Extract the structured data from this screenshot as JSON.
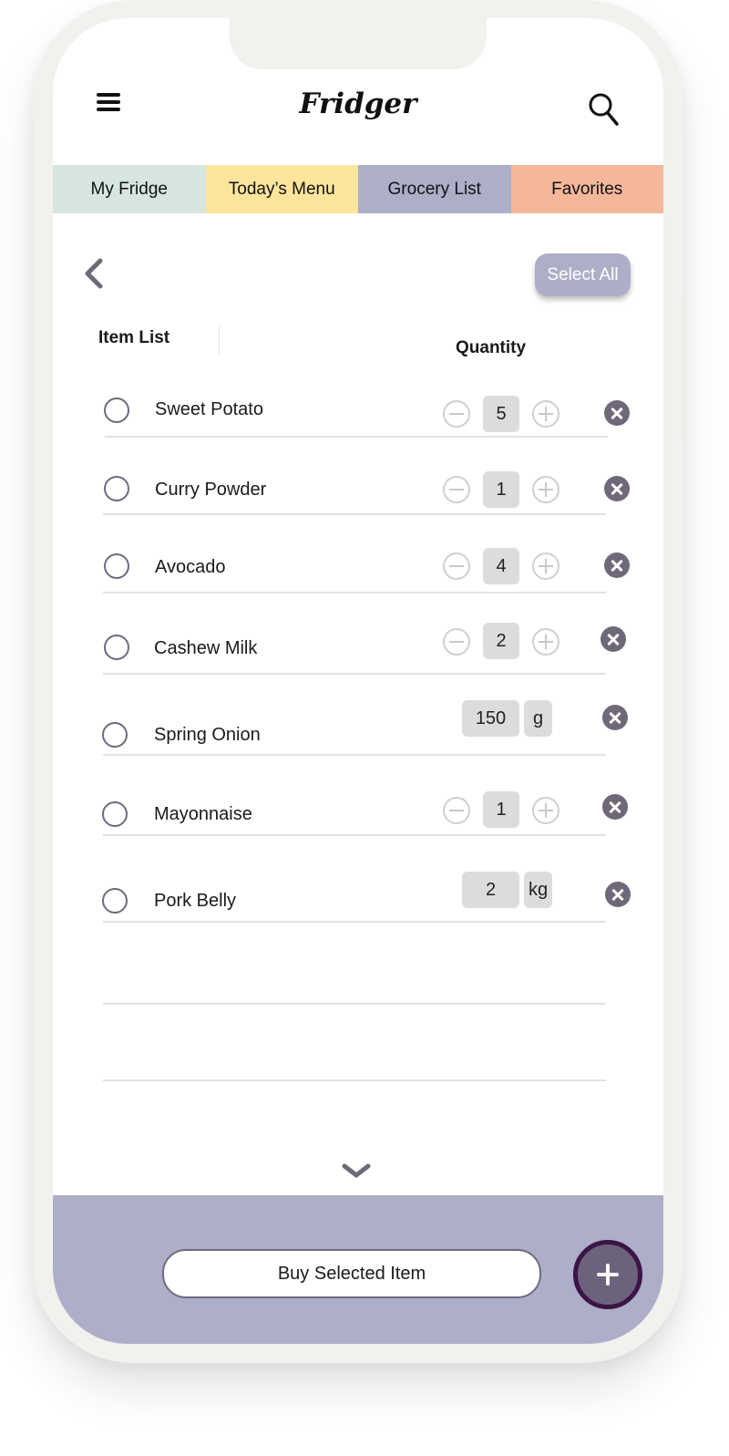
{
  "app": {
    "title": "Fridger"
  },
  "tabs": [
    {
      "label": "My Fridge",
      "color": "#d6e6df"
    },
    {
      "label": "Today’s Menu",
      "color": "#fde59c"
    },
    {
      "label": "Grocery List",
      "color": "#adaec8",
      "active": true
    },
    {
      "label": "Favorites",
      "color": "#f4b79a"
    }
  ],
  "toolbar": {
    "select_all_label": "Select All"
  },
  "columns": {
    "item": "Item List",
    "quantity": "Quantity"
  },
  "items": [
    {
      "name": "Sweet Potato",
      "quantity": "5",
      "mode": "stepper",
      "checked": false
    },
    {
      "name": "Curry Powder",
      "quantity": "1",
      "mode": "stepper",
      "checked": false
    },
    {
      "name": "Avocado",
      "quantity": "4",
      "mode": "stepper",
      "checked": false
    },
    {
      "name": "Cashew Milk",
      "quantity": "2",
      "mode": "stepper",
      "checked": false
    },
    {
      "name": "Spring Onion",
      "quantity": "150",
      "unit": "g",
      "mode": "measure",
      "checked": false
    },
    {
      "name": "Mayonnaise",
      "quantity": "1",
      "mode": "stepper",
      "checked": false
    },
    {
      "name": "Pork Belly",
      "quantity": "2",
      "unit": "kg",
      "mode": "measure",
      "checked": false
    }
  ],
  "footer": {
    "buy_label": "Buy Selected Item"
  },
  "icons": {
    "menu": "hamburger-icon",
    "search": "search-icon",
    "back": "chevron-left-icon",
    "scroll": "chevron-down-icon",
    "add": "plus-icon",
    "remove": "close-icon",
    "decrement": "minus-circle-icon",
    "increment": "plus-circle-icon"
  },
  "colors": {
    "accent": "#adaec8",
    "icon_dark": "#6f6878",
    "fab": "#6c627c",
    "fab_ring": "#3c1446"
  }
}
